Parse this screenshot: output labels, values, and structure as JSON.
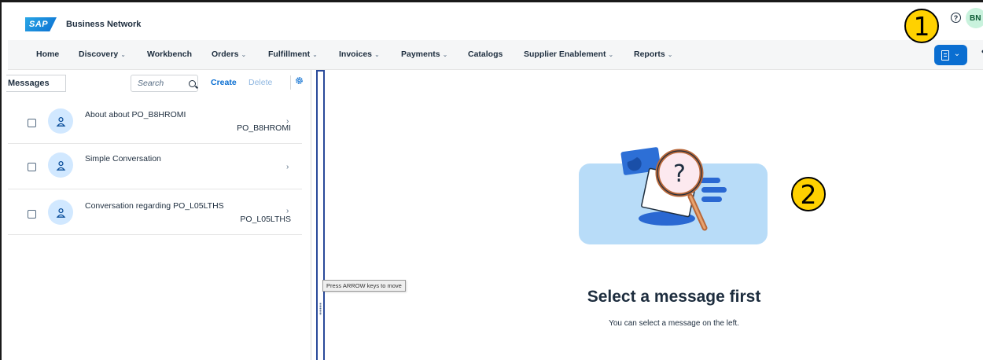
{
  "shell": {
    "logo_text": "SAP",
    "product_name": "Business Network",
    "help_glyph": "?",
    "avatar_initials": "BN"
  },
  "callouts": [
    "1",
    "2"
  ],
  "nav": {
    "items": [
      {
        "label": "Home",
        "has_menu": false
      },
      {
        "label": "Discovery",
        "has_menu": true
      },
      {
        "label": "Workbench",
        "has_menu": false
      },
      {
        "label": "Orders",
        "has_menu": true
      },
      {
        "label": "Fulfillment",
        "has_menu": true
      },
      {
        "label": "Invoices",
        "has_menu": true
      },
      {
        "label": "Payments",
        "has_menu": true
      },
      {
        "label": "Catalogs",
        "has_menu": false
      },
      {
        "label": "Supplier Enablement",
        "has_menu": true
      },
      {
        "label": "Reports",
        "has_menu": true
      }
    ],
    "chevron_glyph": "⌄",
    "more_glyph": "•••",
    "accent_color": "#0a6ed1"
  },
  "messages_panel": {
    "title": "Messages",
    "search_placeholder": "Search",
    "search_value": "",
    "create_label": "Create",
    "delete_label": "Delete",
    "items": [
      {
        "title": "About about PO_B8HROMI",
        "subtitle": "PO_B8HROMI",
        "checked": false
      },
      {
        "title": "Simple Conversation",
        "subtitle": "",
        "checked": false
      },
      {
        "title": "Conversation regarding PO_L05LTHS",
        "subtitle": "PO_L05LTHS",
        "checked": false
      }
    ],
    "arrow_glyph": "›"
  },
  "splitter": {
    "tooltip": "Press ARROW keys to move"
  },
  "empty_state": {
    "title": "Select a message first",
    "description": "You can select a message on the left.",
    "illustration_glyph": "?"
  }
}
